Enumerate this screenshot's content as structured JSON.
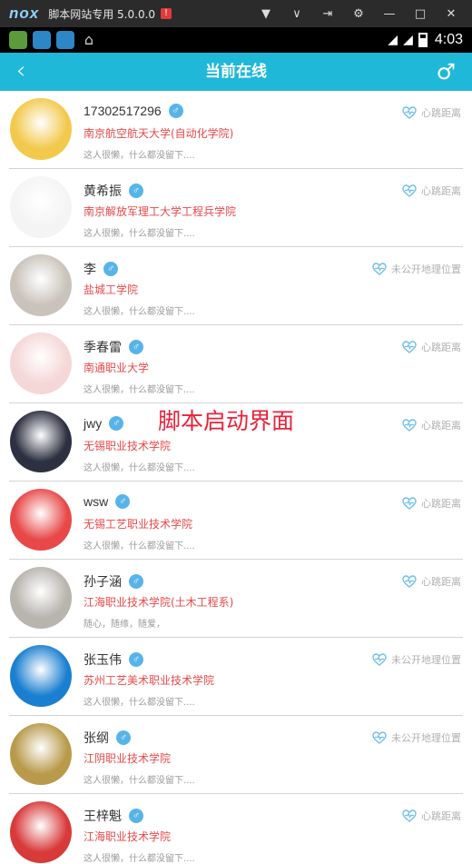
{
  "emulator": {
    "logo": "nox",
    "title": "脚本网站专用  5.0.0.0",
    "warning": "!"
  },
  "status_bar": {
    "time": "4:03"
  },
  "app_bar": {
    "back_icon": "back-chevron-icon",
    "title": "当前在线",
    "gender_icon": "male-symbol-icon",
    "bar_color": "#20b8d8"
  },
  "overlay_text": "脚本启动界面",
  "colors": {
    "school": "#e8484a",
    "badge": "#58b4e8",
    "distance": "#b0b0b0"
  },
  "users": [
    {
      "name": "17302517296",
      "school": "南京航空航天大学(自动化学院)",
      "signature": "这人很懒，什么都没留下....",
      "distance_label": "心跳距离",
      "distance_icon": "heartbeat-icon",
      "avatar_color": "#f2c94c"
    },
    {
      "name": "黄希振",
      "school": "南京解放军理工大学工程兵学院",
      "signature": "这人很懒，什么都没留下....",
      "distance_label": "心跳距离",
      "distance_icon": "heartbeat-icon",
      "avatar_color": "#f4f4f4"
    },
    {
      "name": "李",
      "school": "盐城工学院",
      "signature": "这人很懒，什么都没留下....",
      "distance_label": "未公开地理位置",
      "distance_icon": "heartbeat-icon",
      "avatar_color": "#c9c3bb"
    },
    {
      "name": "季春雷",
      "school": "南通职业大学",
      "signature": "这人很懒，什么都没留下....",
      "distance_label": "心跳距离",
      "distance_icon": "heartbeat-icon",
      "avatar_color": "#f5d7d7"
    },
    {
      "name": "jwy",
      "school": "无锡职业技术学院",
      "signature": "这人很懒，什么都没留下....",
      "distance_label": "心跳距离",
      "distance_icon": "heartbeat-icon",
      "avatar_color": "#2d3040"
    },
    {
      "name": "wsw",
      "school": "无锡工艺职业技术学院",
      "signature": "这人很懒，什么都没留下....",
      "distance_label": "心跳距离",
      "distance_icon": "heartbeat-icon",
      "avatar_color": "#e84848"
    },
    {
      "name": "孙子涵",
      "school": "江海职业技术学院(土木工程系)",
      "signature": "随心，随缘，随爱，",
      "distance_label": "心跳距离",
      "distance_icon": "heartbeat-icon",
      "avatar_color": "#b8b4ae"
    },
    {
      "name": "张玉伟",
      "school": "苏州工艺美术职业技术学院",
      "signature": "这人很懒，什么都没留下....",
      "distance_label": "未公开地理位置",
      "distance_icon": "heartbeat-icon",
      "avatar_color": "#1a7fd0"
    },
    {
      "name": "张纲",
      "school": "江阴职业技术学院",
      "signature": "这人很懒，什么都没留下....",
      "distance_label": "未公开地理位置",
      "distance_icon": "heartbeat-icon",
      "avatar_color": "#b89a4a"
    },
    {
      "name": "王梓魁",
      "school": "江海职业技术学院",
      "signature": "这人很懒，什么都没留下....",
      "distance_label": "心跳距离",
      "distance_icon": "heartbeat-icon",
      "avatar_color": "#d83a3a"
    }
  ]
}
